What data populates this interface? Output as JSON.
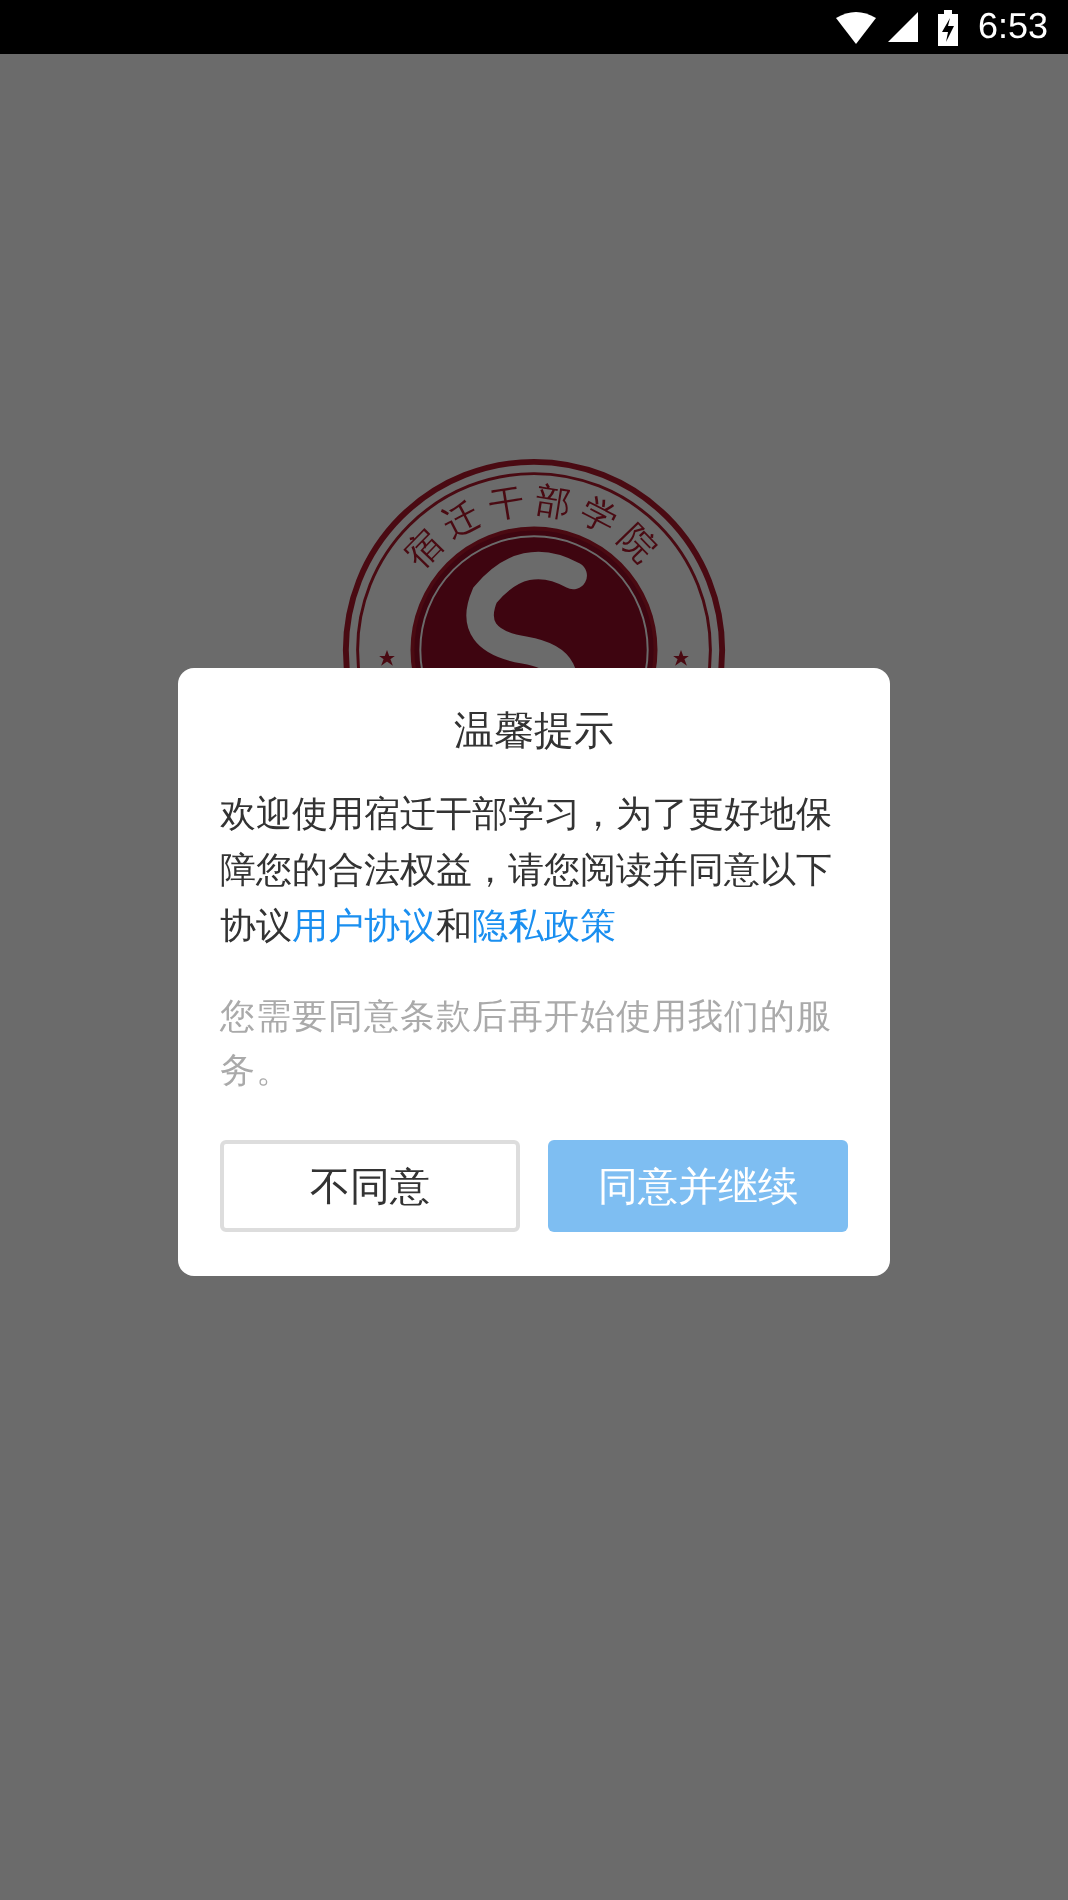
{
  "status_bar": {
    "time": "6:53"
  },
  "logo": {
    "text": "宿迁干部学院"
  },
  "dialog": {
    "title": "温馨提示",
    "message": {
      "lead": "欢迎使用宿迁干部学习，为了更好地保障您的合法权益，请您阅读并同意以下协议",
      "links": [
        "用户协议",
        "隐私政策"
      ],
      "joiner": "和"
    },
    "note": "您需要同意条款后再开始使用我们的服务。",
    "buttons": [
      {
        "label": "不同意",
        "kind": "secondary"
      },
      {
        "label": "同意并继续",
        "kind": "primary"
      }
    ]
  }
}
